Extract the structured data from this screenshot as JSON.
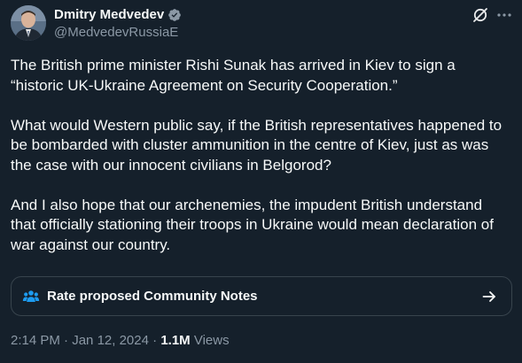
{
  "author": {
    "display_name": "Dmitry Medvedev",
    "handle": "@MedvedevRussiaE",
    "verified": true
  },
  "tweet": {
    "paragraphs": [
      "The British prime minister Rishi Sunak has arrived in Kiev to sign a “historic UK-Ukraine Agreement on Security Cooperation.”",
      "What would Western public say, if the British representatives happened to be bombarded with cluster ammunition in the centre of Kiev, just as was the case with our innocent civilians in Belgorod?",
      "And I also hope that our archenemies, the impudent British understand that officially stationing their troops in Ukraine would mean declaration of war against our country."
    ]
  },
  "community_notes": {
    "label": "Rate proposed Community Notes",
    "icon": "people-icon",
    "arrow_icon": "arrow-right-icon"
  },
  "meta": {
    "time": "2:14 PM",
    "separator": " · ",
    "date": "Jan 12, 2024",
    "views_count": "1.1M",
    "views_label": " Views"
  },
  "icons": {
    "grok": "grok-icon",
    "more": "more-icon"
  },
  "colors": {
    "background": "#15202b",
    "text": "#f7f9f9",
    "secondary_text": "#8b98a5",
    "border": "#38444d",
    "verified_blue": "#1d9bf0"
  }
}
